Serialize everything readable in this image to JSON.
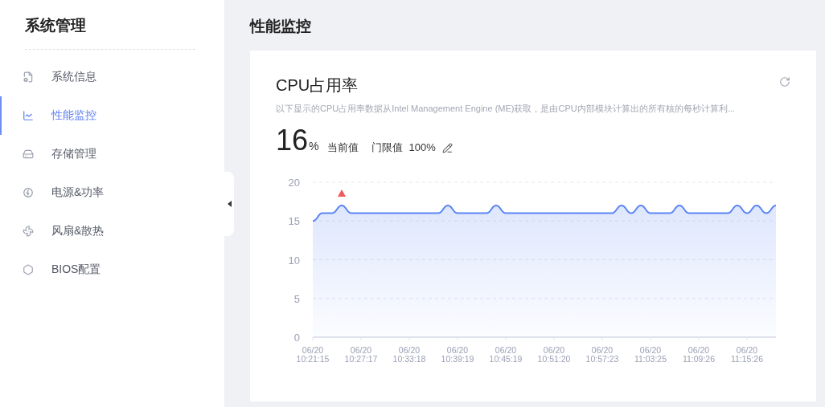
{
  "sidebar": {
    "title": "系统管理",
    "items": [
      {
        "label": "系统信息",
        "selected": false
      },
      {
        "label": "性能监控",
        "selected": true
      },
      {
        "label": "存储管理",
        "selected": false
      },
      {
        "label": "电源&功率",
        "selected": false
      },
      {
        "label": "风扇&散热",
        "selected": false
      },
      {
        "label": "BIOS配置",
        "selected": false
      }
    ]
  },
  "page": {
    "title": "性能监控"
  },
  "card": {
    "title": "CPU占用率",
    "description": "以下显示的CPU占用率数据从Intel Management Engine (ME)获取，是由CPU内部模块计算出的所有核的每秒计算利...",
    "current": {
      "value": "16",
      "unit": "%",
      "label": "当前值"
    },
    "threshold": {
      "label": "门限值",
      "value": "100%"
    },
    "chart_data": {
      "type": "area",
      "categories": [
        "06/20 10:21:15",
        null,
        null,
        null,
        null,
        "06/20 10:27:17",
        null,
        null,
        null,
        null,
        "06/20 10:33:18",
        null,
        null,
        null,
        null,
        "06/20 10:39:19",
        null,
        null,
        null,
        null,
        "06/20 10:45:19",
        null,
        null,
        null,
        null,
        "06/20 10:51:20",
        null,
        null,
        null,
        null,
        "06/20 10:57:23",
        null,
        null,
        null,
        null,
        "06/20 11:03:25",
        null,
        null,
        null,
        null,
        "06/20 11:09:26",
        null,
        null,
        null,
        null,
        "06/20 11:15:26",
        null,
        null,
        null
      ],
      "series": [
        {
          "color": "#5b85f5",
          "values": [
            15,
            16,
            16,
            17,
            16,
            16,
            16,
            16,
            16,
            16,
            16,
            16,
            16,
            16,
            17,
            16,
            16,
            16,
            16,
            17,
            16,
            16,
            16,
            16,
            16,
            16,
            16,
            16,
            16,
            16,
            16,
            16,
            17,
            16,
            17,
            16,
            16,
            16,
            17,
            16,
            16,
            16,
            16,
            16,
            17,
            16,
            17,
            16,
            17
          ]
        }
      ],
      "ylim": [
        0,
        20
      ],
      "yticks": [
        0,
        5,
        10,
        15,
        20
      ],
      "grid": true
    }
  }
}
